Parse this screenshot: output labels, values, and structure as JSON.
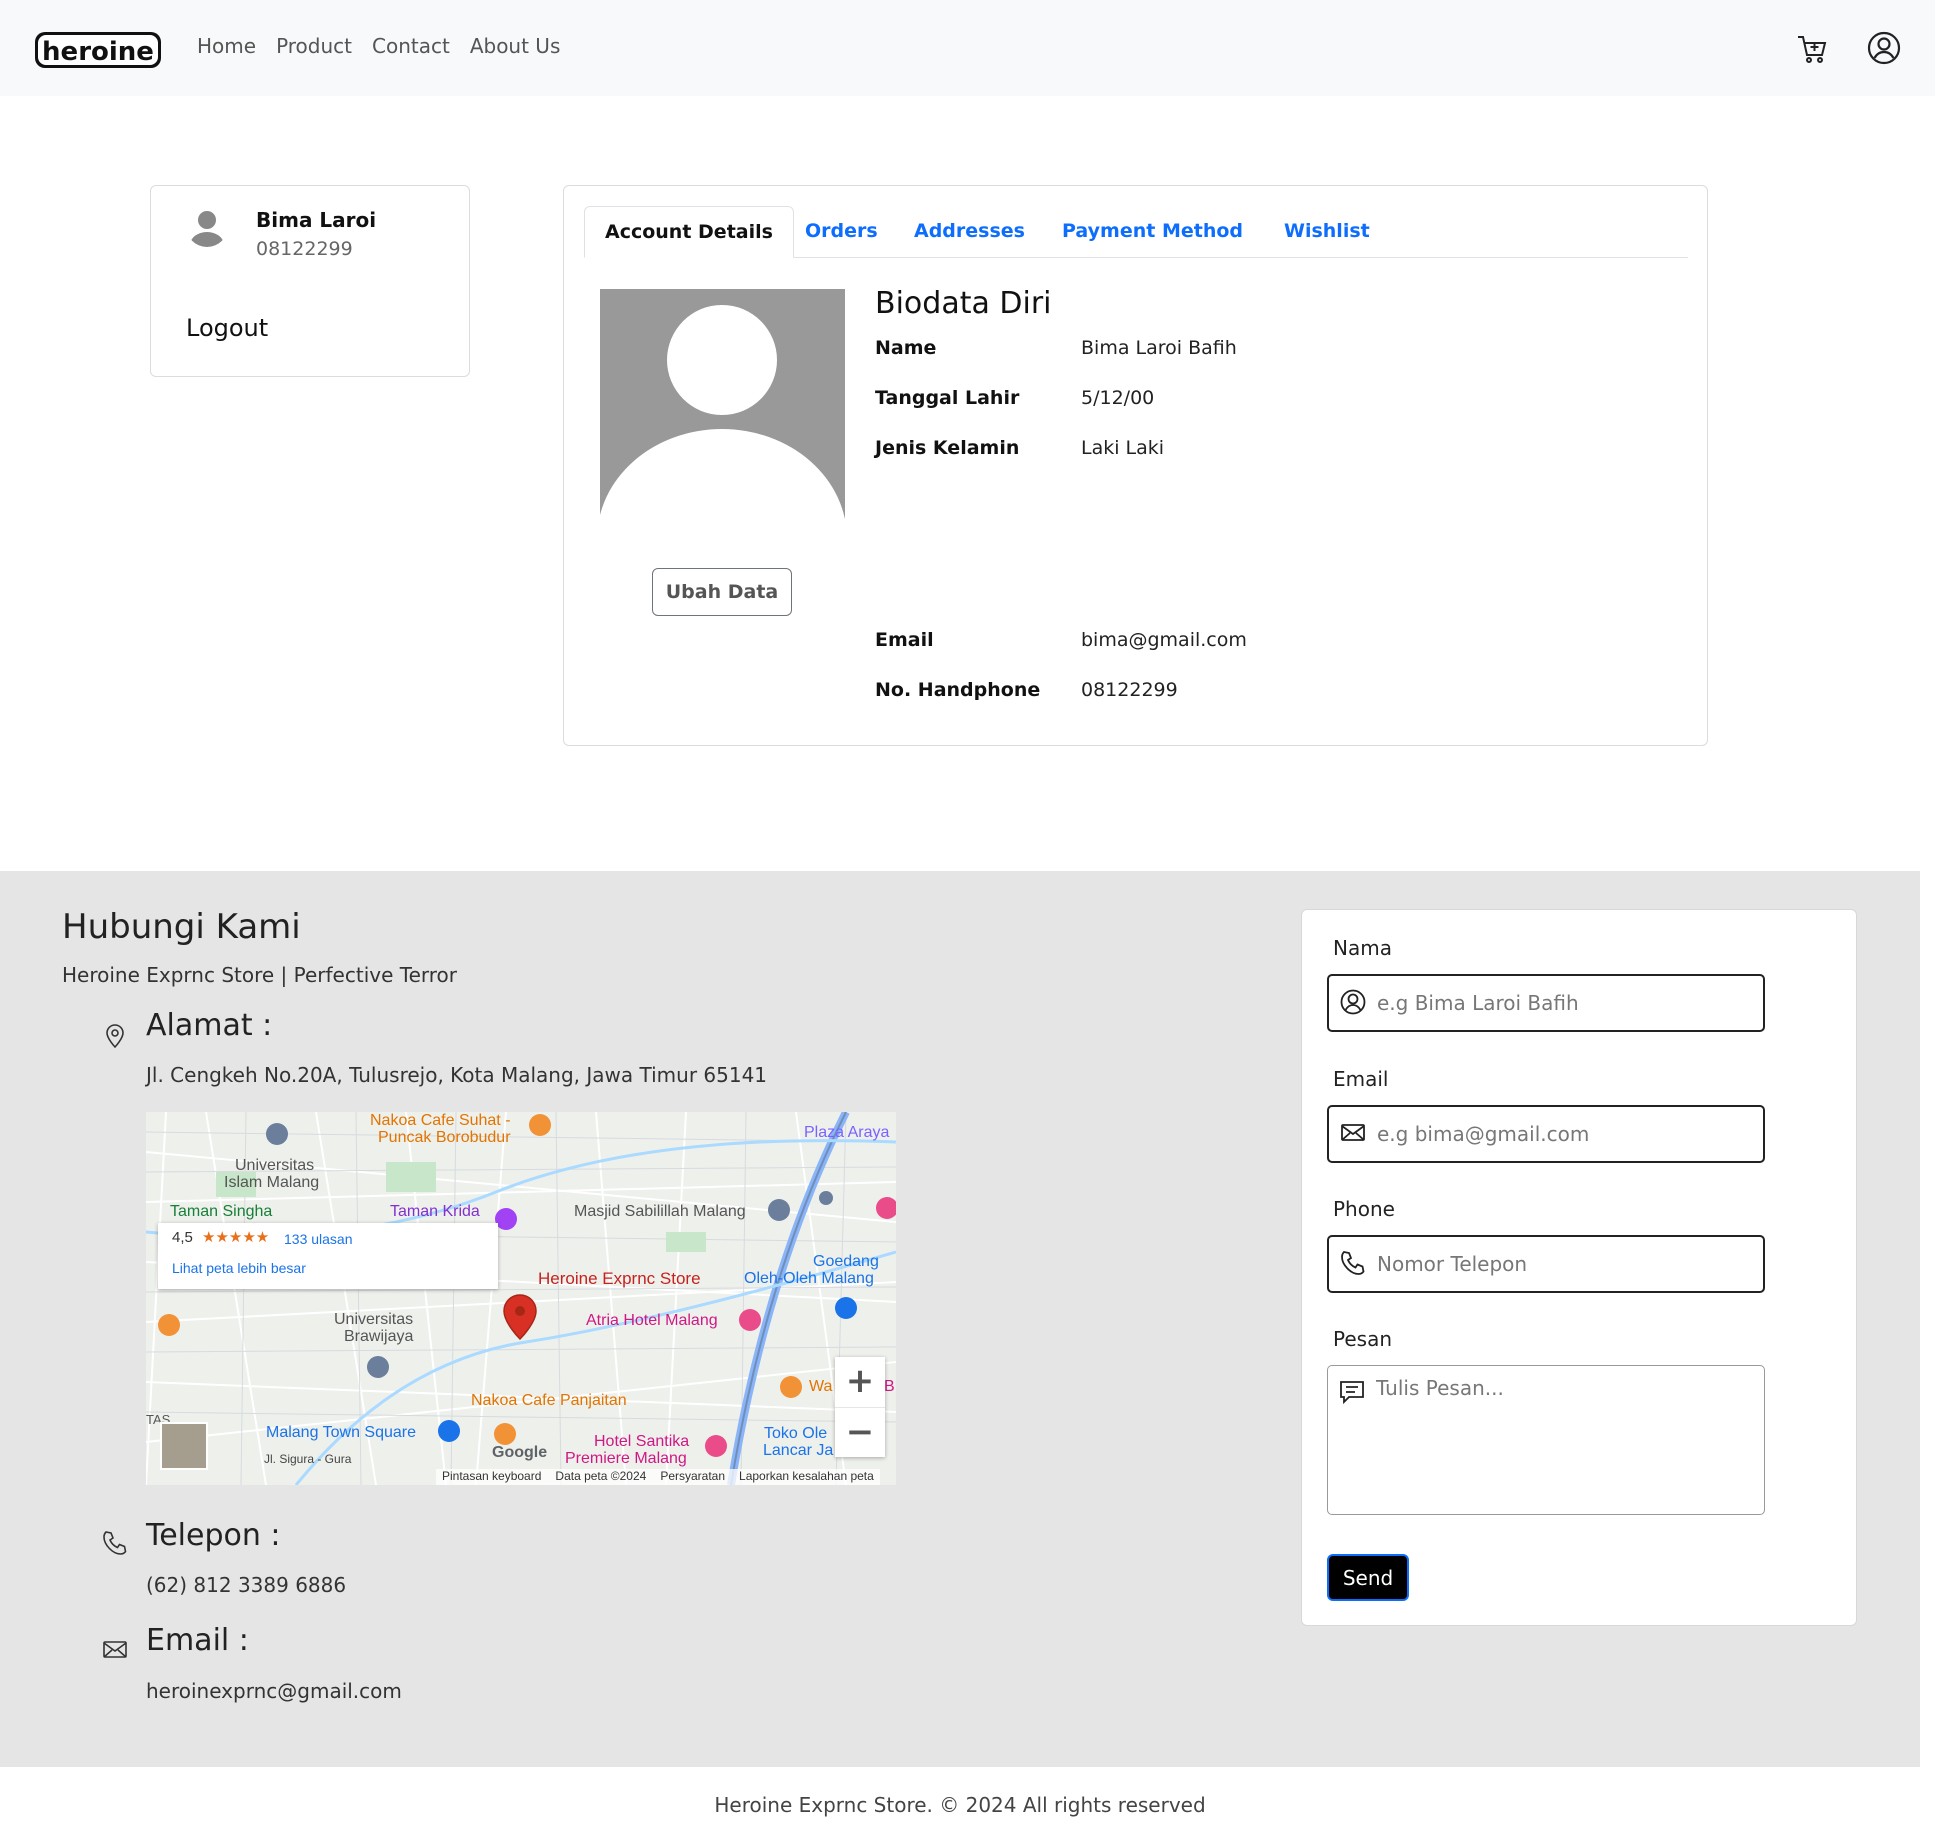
{
  "nav": {
    "logo_text": "heroine",
    "links": [
      "Home",
      "Product",
      "Contact",
      "About Us"
    ]
  },
  "profile": {
    "name": "Bima Laroi",
    "phone": "08122299",
    "logout_label": "Logout"
  },
  "tabs": [
    "Account Details",
    "Orders",
    "Addresses",
    "Payment Method",
    "Wishlist"
  ],
  "biodata": {
    "title": "Biodata Diri",
    "edit_button": "Ubah Data",
    "rows": [
      {
        "label": "Name",
        "value": "Bima Laroi Bafih"
      },
      {
        "label": "Tanggal Lahir",
        "value": "5/12/00"
      },
      {
        "label": "Jenis Kelamin",
        "value": "Laki Laki"
      },
      {
        "label": "Email",
        "value": "bima@gmail.com"
      },
      {
        "label": "No. Handphone",
        "value": "08122299"
      }
    ]
  },
  "contact": {
    "title": "Hubungi Kami",
    "subtitle": "Heroine Exprnc Store | Perfective Terror",
    "address_heading": "Alamat :",
    "address": "Jl. Cengkeh No.20A, Tulusrejo, Kota Malang, Jawa Timur 65141",
    "phone_heading": "Telepon :",
    "phone": "(62) 812 3389 6886",
    "email_heading": "Email :",
    "email": "heroinexprnc@gmail.com"
  },
  "map": {
    "rating": "4,5",
    "stars": "★★★★★",
    "reviews": "133 ulasan",
    "larger_link": "Lihat peta lebih besar",
    "pin_label": "Heroine Exprnc Store",
    "places": [
      "Nakoa Cafe Suhat -",
      "Puncak Borobudur",
      "Plaza Araya",
      "Universitas",
      "Islam Malang",
      "Taman Singha",
      "Taman Krida",
      "Masjid Sabilillah Malang",
      "Goedang",
      "Oleh-Oleh Malang",
      "Atria Hotel Malang",
      "Universitas",
      "Brawijaya",
      "Nakoa Cafe Panjaitan",
      "Malang Town Square",
      "Hotel Santika",
      "Premiere Malang",
      "Toko Ole",
      "Lancar Ja",
      "Jl. Sigura - Gura",
      "Google",
      "Wa",
      "B",
      "TAS"
    ],
    "zoom_in": "+",
    "zoom_out": "−",
    "footer": [
      "Pintasan keyboard",
      "Data peta ©2024",
      "Persyaratan",
      "Laporkan kesalahan peta"
    ]
  },
  "form": {
    "name_label": "Nama",
    "name_placeholder": "e.g Bima Laroi Bafih",
    "email_label": "Email",
    "email_placeholder": "e.g bima@gmail.com",
    "phone_label": "Phone",
    "phone_placeholder": "Nomor Telepon",
    "message_label": "Pesan",
    "message_placeholder": "Tulis Pesan...",
    "send_label": "Send"
  },
  "footer": {
    "text": "Heroine Exprnc Store. © 2024 All rights reserved"
  },
  "colors": {
    "link_blue": "#0d6efd",
    "contact_bg": "#e5e5e5",
    "navbar_bg": "#f8f9fa",
    "avatar_grey": "#999999",
    "map_pin_red": "#d93025"
  }
}
